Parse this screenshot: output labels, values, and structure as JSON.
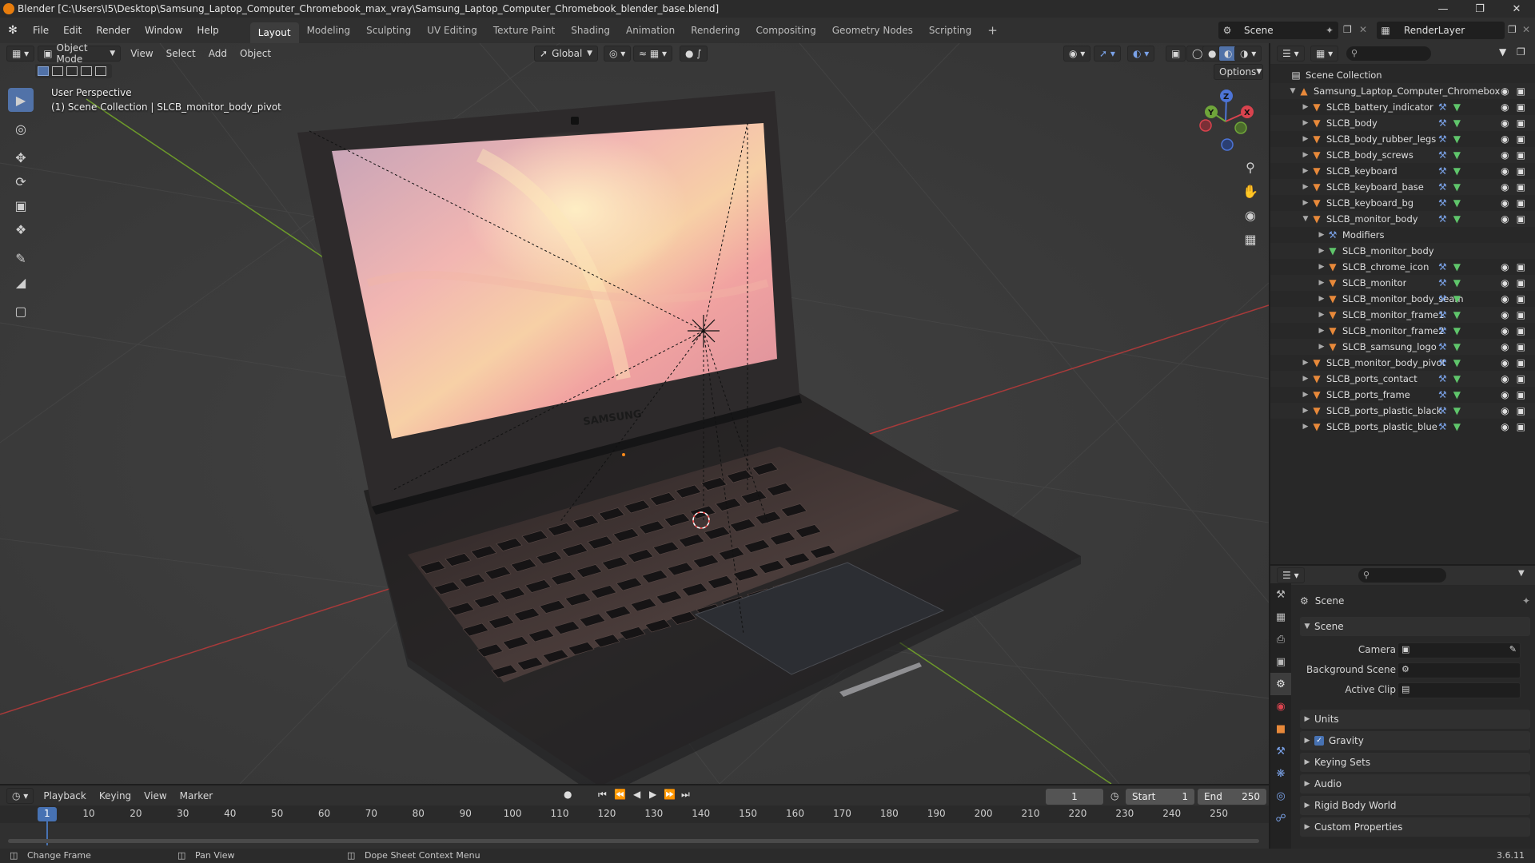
{
  "window": {
    "title": "Blender [C:\\Users\\I5\\Desktop\\Samsung_Laptop_Computer_Chromebook_max_vray\\Samsung_Laptop_Computer_Chromebook_blender_base.blend]"
  },
  "menus": [
    "File",
    "Edit",
    "Render",
    "Window",
    "Help"
  ],
  "workspaces": [
    "Layout",
    "Modeling",
    "Sculpting",
    "UV Editing",
    "Texture Paint",
    "Shading",
    "Animation",
    "Rendering",
    "Compositing",
    "Geometry Nodes",
    "Scripting"
  ],
  "active_workspace": "Layout",
  "topbar": {
    "scene": "Scene",
    "view_layer": "RenderLayer"
  },
  "viewport": {
    "mode": "Object Mode",
    "menus": [
      "View",
      "Select",
      "Add",
      "Object"
    ],
    "transform_orientation": "Global",
    "options_label": "Options",
    "perspective_label": "User Perspective",
    "collection_label": "(1) Scene Collection | SLCB_monitor_body_pivot",
    "brand_text": "SAMSUNG"
  },
  "gizmo": {
    "x": "X",
    "y": "Y",
    "z": "Z"
  },
  "outliner": {
    "root": "Scene Collection",
    "collection": "Samsung_Laptop_Computer_Chromebox",
    "items": [
      "SLCB_battery_indicator",
      "SLCB_body",
      "SLCB_body_rubber_legs",
      "SLCB_body_screws",
      "SLCB_keyboard",
      "SLCB_keyboard_base",
      "SLCB_keyboard_bg",
      "SLCB_monitor_body"
    ],
    "children": [
      "Modifiers",
      "SLCB_monitor_body",
      "SLCB_chrome_icon",
      "SLCB_monitor",
      "SLCB_monitor_body_seam",
      "SLCB_monitor_frame1",
      "SLCB_monitor_frame2",
      "SLCB_samsung_logo"
    ],
    "items_after": [
      "SLCB_monitor_body_pivot",
      "SLCB_ports_contact",
      "SLCB_ports_frame",
      "SLCB_ports_plastic_black",
      "SLCB_ports_plastic_blue"
    ]
  },
  "properties": {
    "context": "Scene",
    "section": "Scene",
    "fields": {
      "camera_label": "Camera",
      "background_label": "Background Scene",
      "clip_label": "Active Clip"
    },
    "subpanels": [
      "Units",
      "Gravity",
      "Keying Sets",
      "Audio",
      "Rigid Body World",
      "Custom Properties"
    ]
  },
  "timeline": {
    "menus": [
      "Playback",
      "Keying",
      "View",
      "Marker"
    ],
    "current_frame": "1",
    "start_label": "Start",
    "start": "1",
    "end_label": "End",
    "end": "250",
    "ticks": [
      "1",
      "10",
      "20",
      "30",
      "40",
      "50",
      "60",
      "70",
      "80",
      "90",
      "100",
      "110",
      "120",
      "130",
      "140",
      "150",
      "160",
      "170",
      "180",
      "190",
      "200",
      "210",
      "220",
      "230",
      "240",
      "250"
    ]
  },
  "statusbar": {
    "hint1": "Change Frame",
    "hint2": "Pan View",
    "hint3": "Dope Sheet Context Menu",
    "version": "3.6.11"
  }
}
